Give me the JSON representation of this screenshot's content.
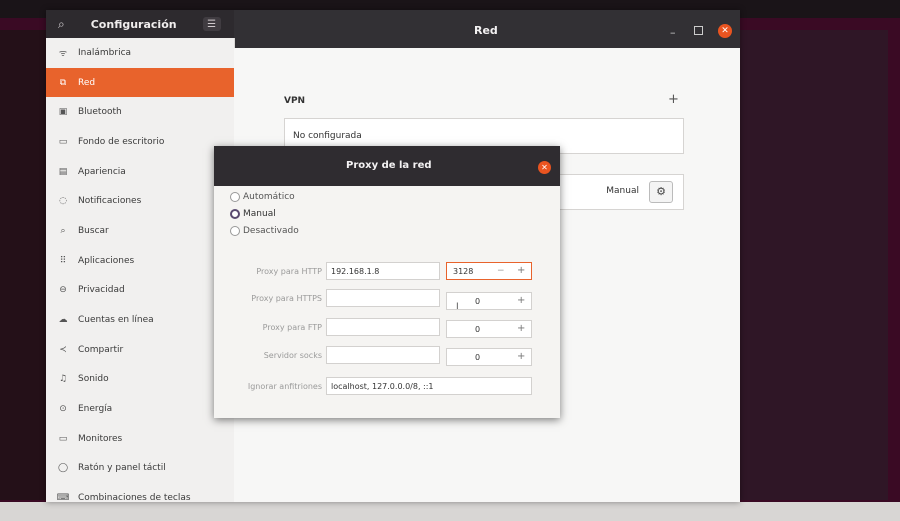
{
  "settings": {
    "sidebar_title": "Configuración",
    "window_title": "Red",
    "sidebar_items": [
      {
        "label": "Inalámbrica",
        "icon": "wifi-icon"
      },
      {
        "label": "Red",
        "icon": "network-icon",
        "active": true
      },
      {
        "label": "Bluetooth",
        "icon": "bluetooth-icon"
      },
      {
        "label": "Fondo de escritorio",
        "icon": "wallpaper-icon"
      },
      {
        "label": "Apariencia",
        "icon": "appearance-icon"
      },
      {
        "label": "Notificaciones",
        "icon": "bell-icon"
      },
      {
        "label": "Buscar",
        "icon": "search-icon"
      },
      {
        "label": "Aplicaciones",
        "icon": "apps-icon"
      },
      {
        "label": "Privacidad",
        "icon": "lock-icon"
      },
      {
        "label": "Cuentas en línea",
        "icon": "cloud-icon"
      },
      {
        "label": "Compartir",
        "icon": "share-icon"
      },
      {
        "label": "Sonido",
        "icon": "music-icon"
      },
      {
        "label": "Energía",
        "icon": "power-icon"
      },
      {
        "label": "Monitores",
        "icon": "monitor-icon"
      },
      {
        "label": "Ratón y panel táctil",
        "icon": "mouse-icon"
      },
      {
        "label": "Combinaciones de teclas",
        "icon": "keyboard-icon"
      }
    ],
    "vpn": {
      "label": "VPN",
      "add": "+",
      "status": "No configurada"
    },
    "proxy": {
      "mode": "Manual"
    }
  },
  "dialog": {
    "title": "Proxy de la red",
    "modes": [
      {
        "label": "Automático",
        "selected": false
      },
      {
        "label": "Manual",
        "selected": true
      },
      {
        "label": "Desactivado",
        "selected": false
      }
    ],
    "fields": [
      {
        "label": "Proxy para HTTP",
        "value": "192.168.1.8",
        "port": "3128"
      },
      {
        "label": "Proxy para HTTPS",
        "value": "",
        "port": "0"
      },
      {
        "label": "Proxy para FTP",
        "value": "",
        "port": "0"
      },
      {
        "label": "Servidor socks",
        "value": "",
        "port": "0"
      }
    ],
    "ignore_label": "Ignorar anfitriones",
    "ignore_value": "localhost, 127.0.0.0/8, ::1"
  },
  "colors": {
    "accent": "#e8632c",
    "headerbar": "#323034",
    "close": "#e95420"
  }
}
